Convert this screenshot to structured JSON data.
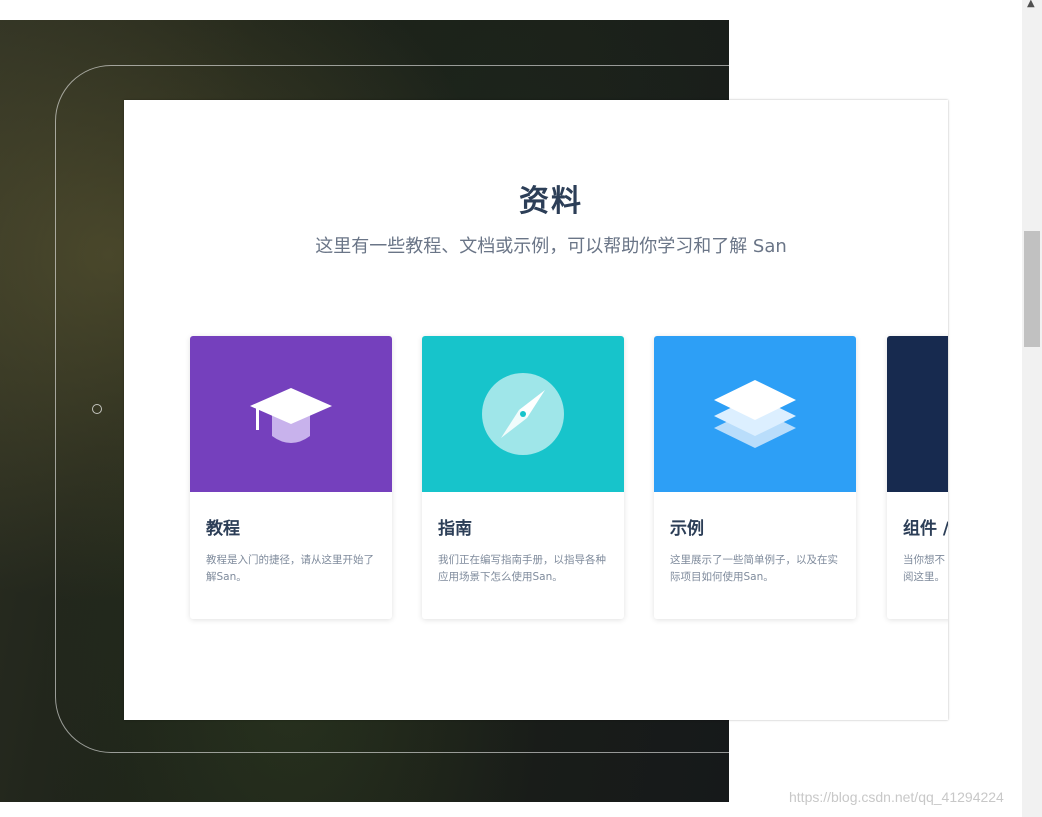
{
  "section": {
    "title": "资料",
    "subtitle": "这里有一些教程、文档或示例，可以帮助你学习和了解 San"
  },
  "cards": [
    {
      "title": "教程",
      "description": "教程是入门的捷径，请从这里开始了解San。",
      "color": "#7540bd",
      "icon": "graduation-cap-icon"
    },
    {
      "title": "指南",
      "description": "我们正在编写指南手册，以指导各种应用场景下怎么使用San。",
      "color": "#17c4cb",
      "icon": "compass-icon"
    },
    {
      "title": "示例",
      "description": "这里展示了一些简单例子，以及在实际项目如何使用San。",
      "color": "#2d9ff6",
      "icon": "layers-icon"
    },
    {
      "title": "组件 /",
      "description": "当你想不\n阅这里。",
      "color": "#172a4f",
      "icon": ""
    }
  ],
  "watermark": "https://blog.csdn.net/qq_41294224"
}
